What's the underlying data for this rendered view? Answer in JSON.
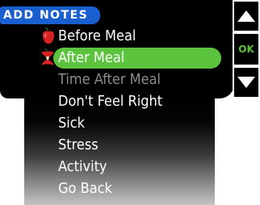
{
  "header": {
    "title": "ADD NOTES"
  },
  "menu": {
    "items": [
      {
        "label": "Before Meal"
      },
      {
        "label": "After Meal"
      },
      {
        "label": "Time After Meal"
      },
      {
        "label": "Don't Feel Right"
      },
      {
        "label": "Sick"
      },
      {
        "label": "Stress"
      },
      {
        "label": "Activity"
      },
      {
        "label": "Go Back"
      }
    ],
    "selected_index": 1,
    "disabled_index": 2,
    "highlight_color": "#5cc33e"
  },
  "buttons": {
    "ok_label": "OK"
  },
  "icons": {
    "before_meal": "apple-icon",
    "after_meal": "apple-core-icon"
  },
  "colors": {
    "header_bg": "#1a5fd0",
    "accent": "#5cc33e"
  }
}
